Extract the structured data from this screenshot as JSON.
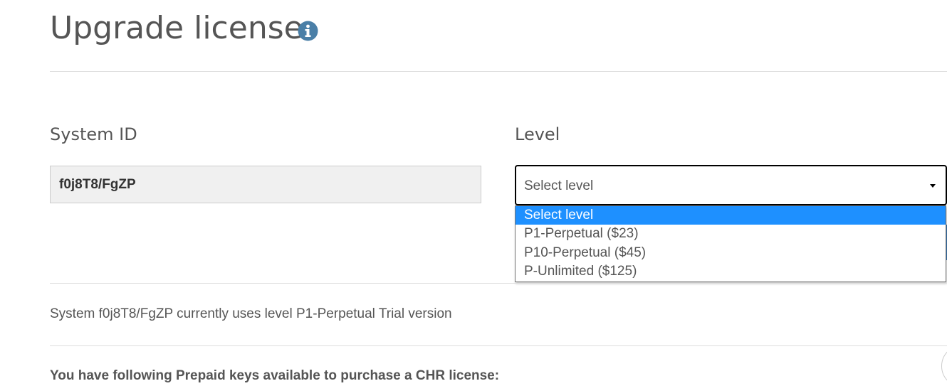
{
  "header": {
    "title": "Upgrade license",
    "info_icon": "info-circle-icon",
    "info_icon_color": "#4a7fa7"
  },
  "form": {
    "system_id_label": "System ID",
    "system_id_value": "f0j8T8/FgZP",
    "level_label": "Level",
    "level_select": {
      "selected": "Select level",
      "options": [
        "Select level",
        "P1-Perpetual ($23)",
        "P10-Perpetual ($45)",
        "P-Unlimited ($125)"
      ],
      "highlight_color": "#1e90ff"
    }
  },
  "status": {
    "text": "System f0j8T8/FgZP currently uses level P1-Perpetual Trial version"
  },
  "prepaid": {
    "text": "You have following Prepaid keys available to purchase a CHR license:"
  }
}
